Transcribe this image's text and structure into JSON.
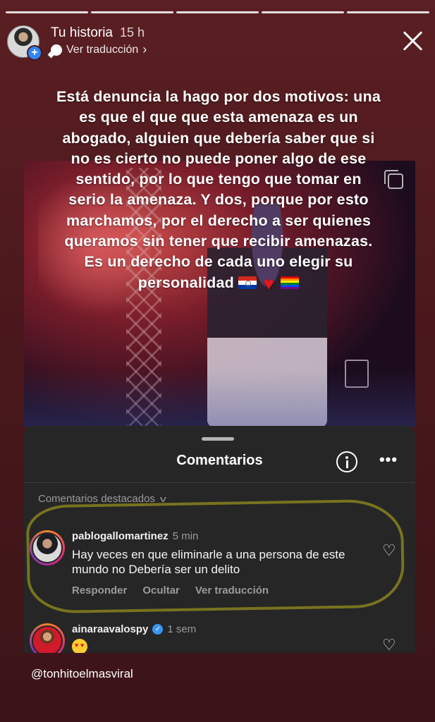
{
  "story": {
    "progress_segments": 5,
    "title": "Tu historia",
    "time": "15 h",
    "translate_label": "Ver traducción",
    "text_lines": [
      "Está denuncia la hago por dos motivos: una",
      "es que el que que esta amenaza es un",
      "abogado, alguien que debería saber que si",
      "no es cierto no puede poner algo de ese",
      "sentido, por lo que tengo que tomar en",
      "serio la amenaza. Y dos, porque por esto",
      "marchamos, por el derecho a ser quienes",
      "queramos sin tener que recibir amenazas.",
      "Es un derecho de cada uno elegir su",
      "personalidad"
    ],
    "text_emojis": [
      "paraguay-flag",
      "red-heart",
      "rainbow-flag"
    ],
    "mention": "@tonhitoelmasviral"
  },
  "comments_sheet": {
    "title": "Comentarios",
    "featured_label": "Comentarios destacados",
    "comments": [
      {
        "username": "pablogallomartinez",
        "time": "5 min",
        "text": "Hay veces en que eliminarle a una persona de este mundo no Debería ser un delito",
        "actions": [
          "Responder",
          "Ocultar",
          "Ver traducción"
        ]
      },
      {
        "username": "ainaraavalospy",
        "verified": true,
        "time": "1 sem",
        "emoji": "heart-eyes"
      }
    ]
  },
  "colors": {
    "story_bg": "#4a181c",
    "sheet_bg": "#262626",
    "highlight_marker": "#968c1e",
    "verified_blue": "#3897f0"
  }
}
